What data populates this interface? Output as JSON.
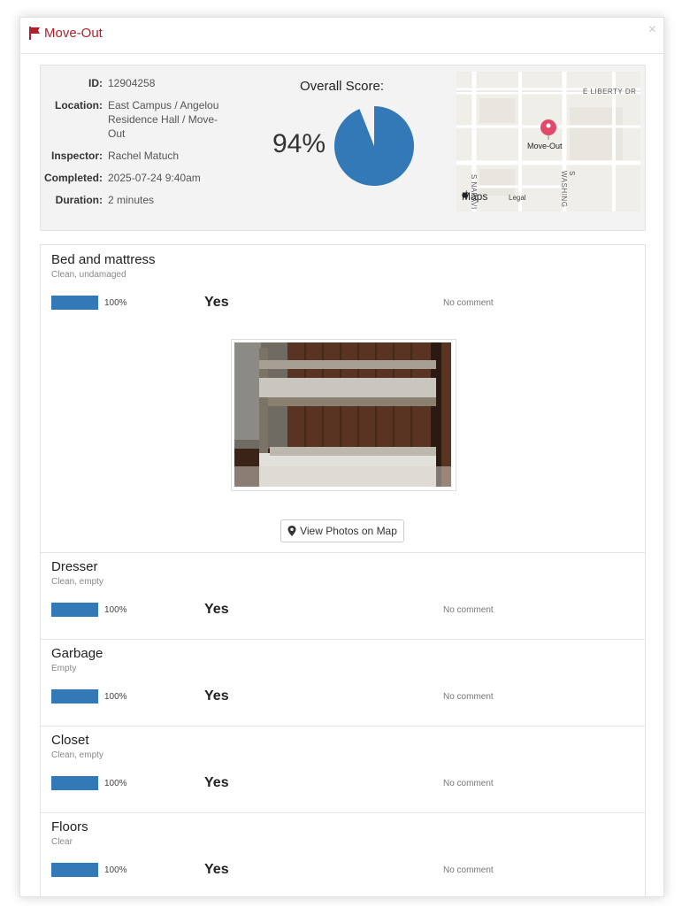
{
  "modal": {
    "title": "Move-Out",
    "close_label": "×"
  },
  "summary": {
    "id_label": "ID:",
    "id_value": "12904258",
    "location_label": "Location:",
    "location_value": "East Campus / Angelou Residence Hall / Move-Out",
    "inspector_label": "Inspector:",
    "inspector_value": "Rachel Matuch",
    "completed_label": "Completed:",
    "completed_value": "2025-07-24 9:40am",
    "duration_label": "Duration:",
    "duration_value": "2 minutes",
    "score_title": "Overall Score:",
    "score_text": "94%",
    "score_fraction": 0.94,
    "score_color": "#3479b7"
  },
  "map": {
    "street_top": "E LIBERTY DR",
    "street_left": "S NAPAVI",
    "street_right": "S WASHING",
    "pin_label": "Move-Out",
    "logo_text": "Maps",
    "legal_text": "Legal"
  },
  "items": [
    {
      "name": "Bed and mattress",
      "subtitle": "Clean, undamaged",
      "percent": "100%",
      "answer": "Yes",
      "comment": "No comment"
    },
    {
      "name": "Dresser",
      "subtitle": "Clean, empty",
      "percent": "100%",
      "answer": "Yes",
      "comment": "No comment"
    },
    {
      "name": "Garbage",
      "subtitle": "Empty",
      "percent": "100%",
      "answer": "Yes",
      "comment": "No comment"
    },
    {
      "name": "Closet",
      "subtitle": "Clean, empty",
      "percent": "100%",
      "answer": "Yes",
      "comment": "No comment"
    },
    {
      "name": "Floors",
      "subtitle": "Clear",
      "percent": "100%",
      "answer": "Yes",
      "comment": "No comment"
    }
  ],
  "photo_button": {
    "label": "View Photos on Map",
    "icon": "map-marker-icon"
  },
  "colors": {
    "accent_red": "#b0202a",
    "bar_blue": "#3479b7"
  }
}
